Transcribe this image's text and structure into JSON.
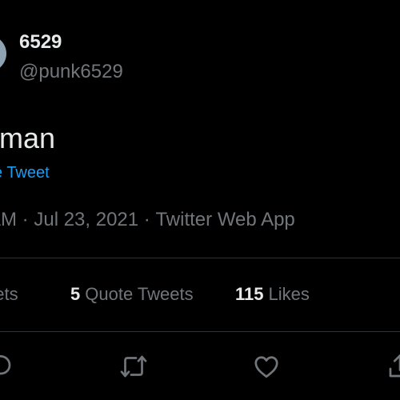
{
  "profile": {
    "display_name": "6529",
    "handle": "@punk6529"
  },
  "tweet": {
    "text": "tman",
    "translate_label": "e Tweet",
    "time": "AM",
    "separator1": "·",
    "date": "Jul 23, 2021",
    "separator2": "·",
    "source": "Twitter Web App"
  },
  "stats": {
    "retweets_label": "eets",
    "quotes_count": "5",
    "quotes_label": "Quote Tweets",
    "likes_count": "115",
    "likes_label": "Likes"
  },
  "actions": {
    "icons": [
      "reply-icon",
      "retweet-icon",
      "like-icon",
      "share-icon"
    ]
  },
  "colors": {
    "background": "#000000",
    "text_primary": "#e7e9ea",
    "text_secondary": "#71767b",
    "link": "#1d9bf0",
    "divider": "#2f3336"
  }
}
